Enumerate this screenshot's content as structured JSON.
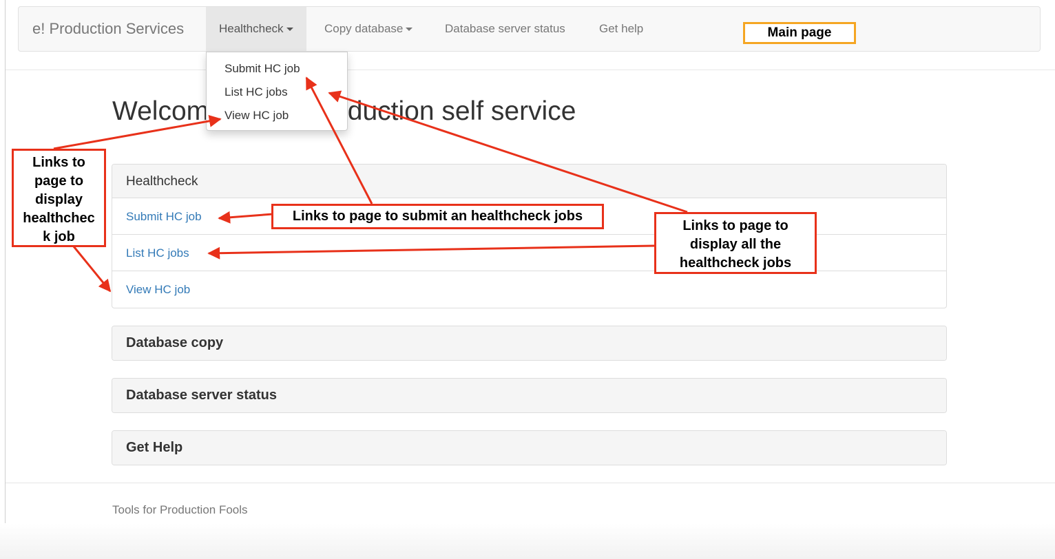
{
  "navbar": {
    "brand": "e! Production Services",
    "items": [
      {
        "label": "Healthcheck",
        "has_caret": true,
        "active": true
      },
      {
        "label": "Copy database",
        "has_caret": true,
        "active": false
      },
      {
        "label": "Database server status",
        "has_caret": false,
        "active": false
      },
      {
        "label": "Get help",
        "has_caret": false,
        "active": false
      }
    ]
  },
  "dropdown": {
    "items": [
      "Submit HC job",
      "List HC jobs",
      "View HC job"
    ]
  },
  "main": {
    "title": "Welcome to the Production self service",
    "panels": [
      {
        "heading": "Healthcheck",
        "links": [
          "Submit HC job",
          "List HC jobs",
          "View HC job"
        ]
      },
      {
        "heading": "Database copy"
      },
      {
        "heading": "Database server status"
      },
      {
        "heading": "Get Help"
      }
    ]
  },
  "footer": {
    "text": "Tools for Production Fools"
  },
  "annotations": {
    "main_page": "Main page",
    "view_job_lines": [
      "Links to",
      "page to",
      "display",
      "healthchec",
      "k job"
    ],
    "submit_jobs": "Links to page to submit an healthcheck jobs",
    "list_jobs_lines": [
      "Links to page to",
      "display all the",
      "healthcheck jobs"
    ]
  },
  "colors": {
    "annotation_red": "#e8311a",
    "annotation_orange": "#f5a623",
    "link_blue": "#337ab7",
    "navbar_bg": "#f8f8f8"
  }
}
